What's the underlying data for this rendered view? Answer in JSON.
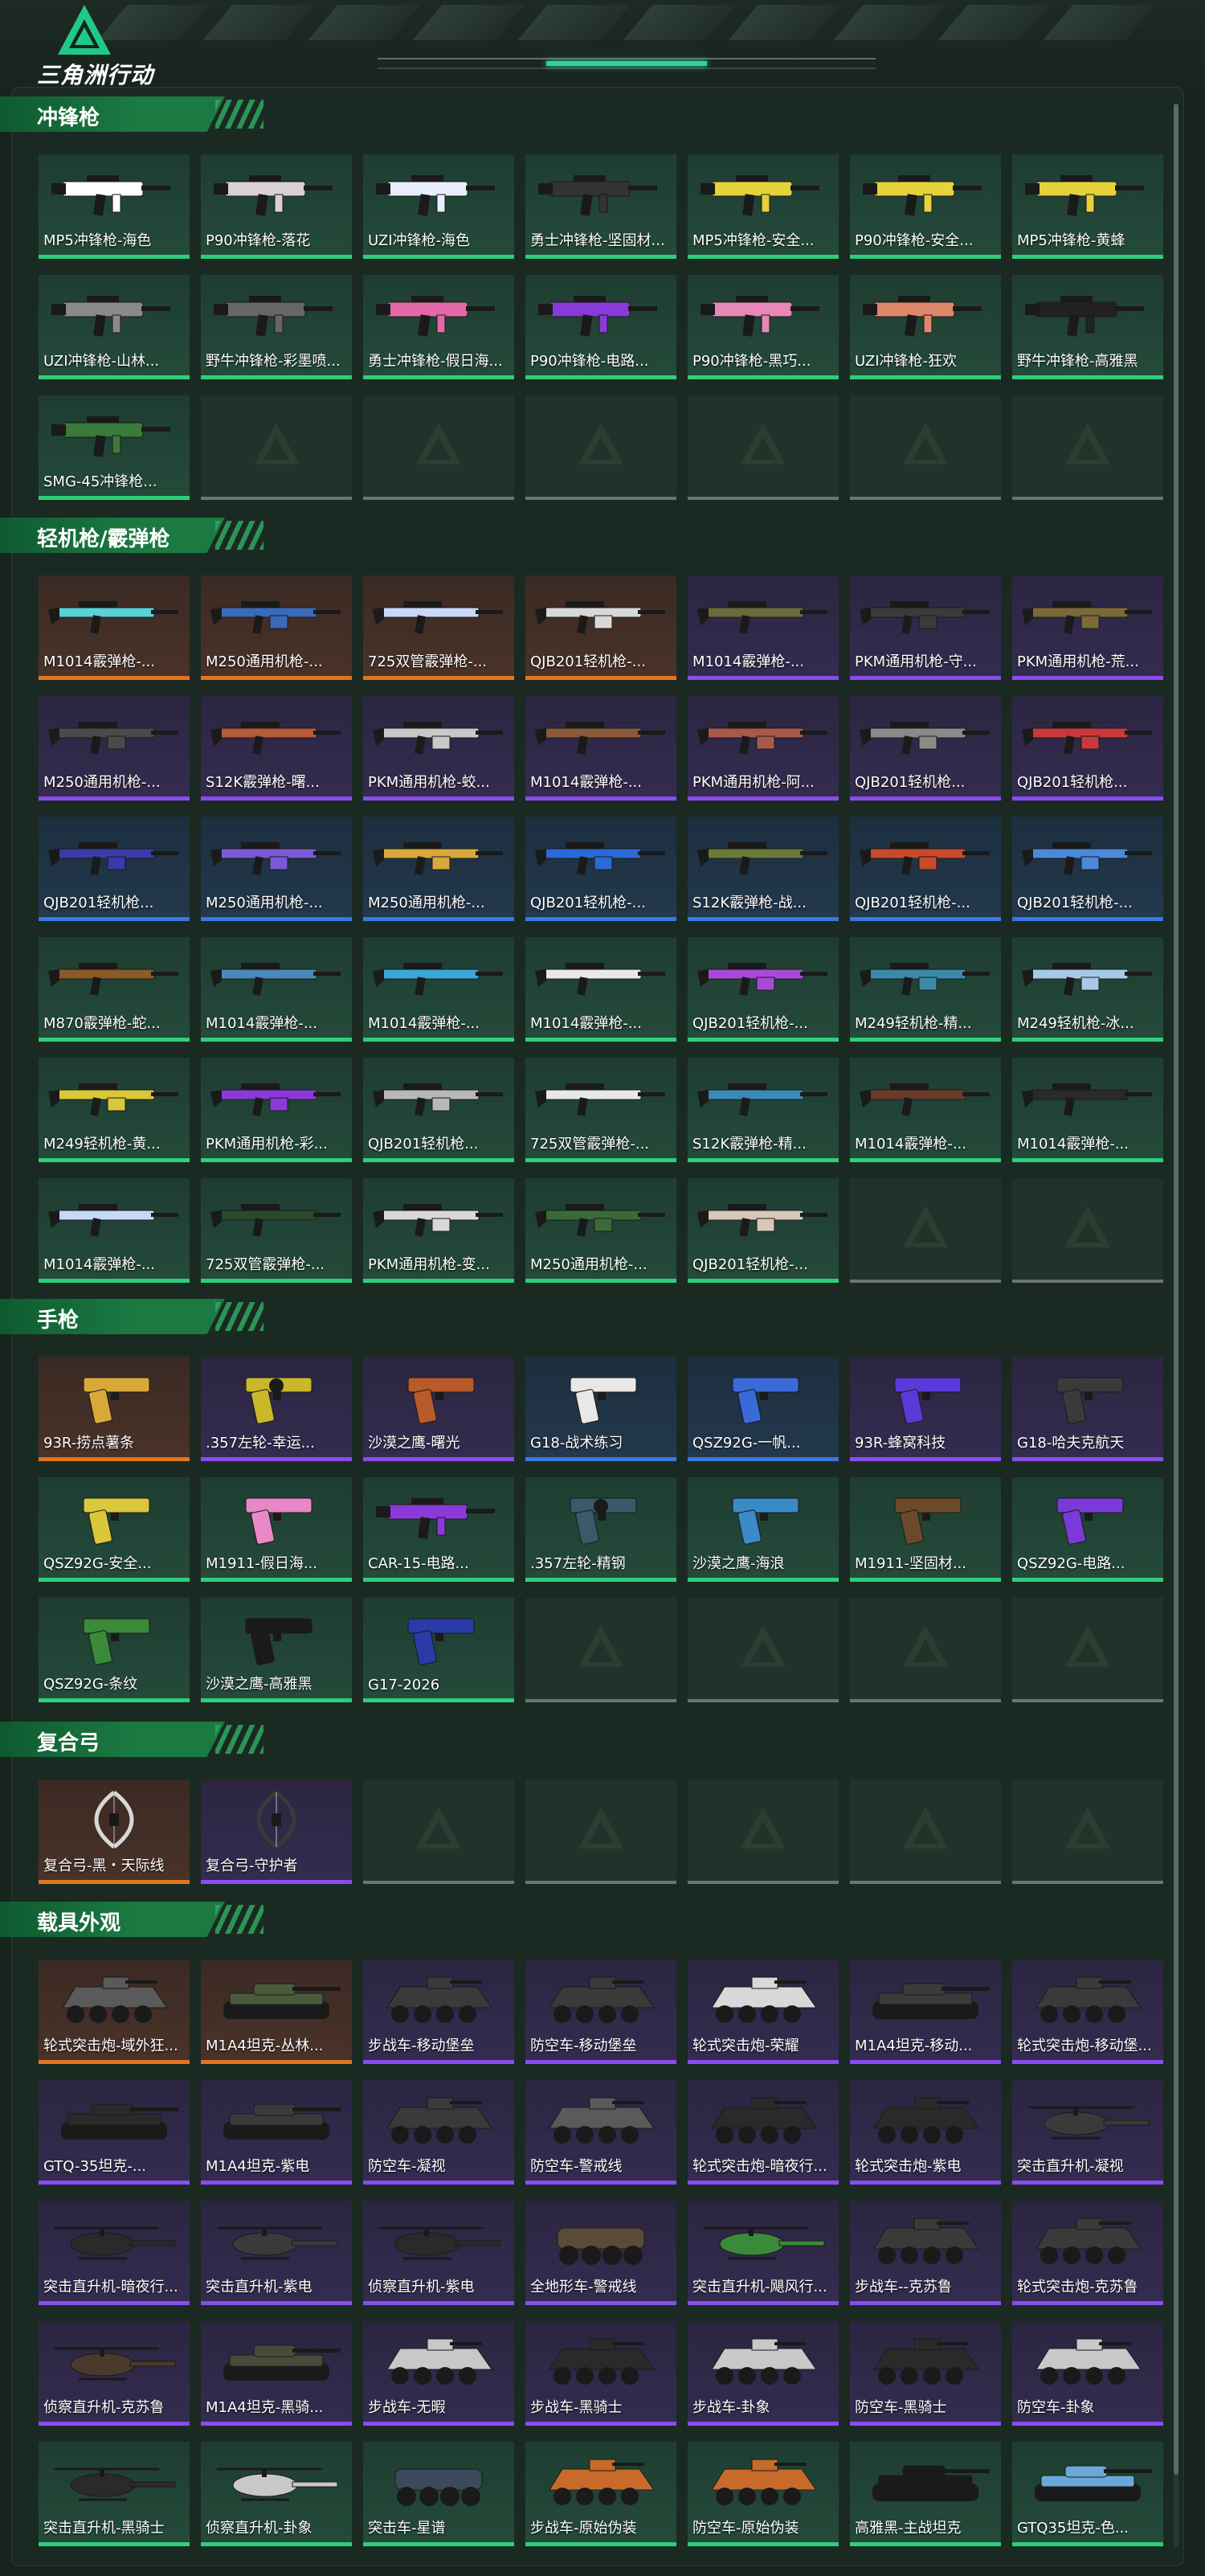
{
  "header": {
    "brand": "三角洲行动",
    "logo_icon": "delta-triangle-logo-icon"
  },
  "rarity_colors": {
    "green": "#2ecf7a",
    "blue": "#3a78e0",
    "purple": "#8a4cf0",
    "orange": "#e0761e",
    "empty": "#6b756f"
  },
  "sections": [
    {
      "title": "冲锋枪",
      "items": [
        {
          "label": "MP5冲锋枪-海色",
          "rarity": "green",
          "icon": "smg-icon",
          "color": "#ffffff"
        },
        {
          "label": "P90冲锋枪-落花",
          "rarity": "green",
          "icon": "smg-p90-icon",
          "color": "#d9d0d8"
        },
        {
          "label": "UZI冲锋枪-海色",
          "rarity": "green",
          "icon": "smg-icon",
          "color": "#e8eefc"
        },
        {
          "label": "勇士冲锋枪-坚固材...",
          "rarity": "green",
          "icon": "smg-icon",
          "color": "#333333"
        },
        {
          "label": "MP5冲锋枪-安全...",
          "rarity": "green",
          "icon": "smg-icon",
          "color": "#e6d23a"
        },
        {
          "label": "P90冲锋枪-安全...",
          "rarity": "green",
          "icon": "smg-p90-icon",
          "color": "#e6d23a"
        },
        {
          "label": "MP5冲锋枪-黄蜂",
          "rarity": "green",
          "icon": "smg-icon",
          "color": "#e6d23a"
        },
        {
          "label": "UZI冲锋枪-山林...",
          "rarity": "green",
          "icon": "smg-icon",
          "color": "#8a8a8a"
        },
        {
          "label": "野牛冲锋枪-彩墨喷...",
          "rarity": "green",
          "icon": "smg-icon",
          "color": "#666666"
        },
        {
          "label": "勇士冲锋枪-假日海...",
          "rarity": "green",
          "icon": "smg-icon",
          "color": "#e36aa8"
        },
        {
          "label": "P90冲锋枪-电路...",
          "rarity": "green",
          "icon": "smg-p90-icon",
          "color": "#8a3ad8"
        },
        {
          "label": "P90冲锋枪-黑巧...",
          "rarity": "green",
          "icon": "smg-p90-icon",
          "color": "#e888b8"
        },
        {
          "label": "UZI冲锋枪-狂欢",
          "rarity": "green",
          "icon": "smg-icon",
          "color": "#e0866a"
        },
        {
          "label": "野牛冲锋枪-高雅黑",
          "rarity": "green",
          "icon": "smg-icon",
          "color": "#222222"
        },
        {
          "label": "SMG-45冲锋枪...",
          "rarity": "green",
          "icon": "smg-icon",
          "color": "#3a7a3a"
        },
        {
          "empty": true
        },
        {
          "empty": true
        },
        {
          "empty": true
        },
        {
          "empty": true
        },
        {
          "empty": true
        },
        {
          "empty": true
        }
      ]
    },
    {
      "title": "轻机枪/霰弹枪",
      "items": [
        {
          "label": "M1014霰弹枪-...",
          "rarity": "orange",
          "icon": "shotgun-icon",
          "color": "#5ad0d8"
        },
        {
          "label": "M250通用机枪-...",
          "rarity": "orange",
          "icon": "lmg-icon",
          "color": "#3a6ab8"
        },
        {
          "label": "725双管霰弹枪-...",
          "rarity": "orange",
          "icon": "shotgun-icon",
          "color": "#c8d8f8"
        },
        {
          "label": "QJB201轻机枪-...",
          "rarity": "orange",
          "icon": "lmg-icon",
          "color": "#d8d8d8"
        },
        {
          "label": "M1014霰弹枪-...",
          "rarity": "purple",
          "icon": "shotgun-icon",
          "color": "#6a6a3a"
        },
        {
          "label": "PKM通用机枪-守...",
          "rarity": "purple",
          "icon": "lmg-icon",
          "color": "#3a3a3a"
        },
        {
          "label": "PKM通用机枪-荒...",
          "rarity": "purple",
          "icon": "lmg-icon",
          "color": "#7a6a3a"
        },
        {
          "label": "M250通用机枪-...",
          "rarity": "purple",
          "icon": "lmg-icon",
          "color": "#4a4a4a"
        },
        {
          "label": "S12K霰弹枪-曙...",
          "rarity": "purple",
          "icon": "shotgun-icon",
          "color": "#b85a3a"
        },
        {
          "label": "PKM通用机枪-蛟...",
          "rarity": "purple",
          "icon": "lmg-icon",
          "color": "#c8c8c8"
        },
        {
          "label": "M1014霰弹枪-...",
          "rarity": "purple",
          "icon": "shotgun-icon",
          "color": "#8a5a3a"
        },
        {
          "label": "PKM通用机枪-阿...",
          "rarity": "purple",
          "icon": "lmg-icon",
          "color": "#a85a4a"
        },
        {
          "label": "QJB201轻机枪...",
          "rarity": "purple",
          "icon": "lmg-icon",
          "color": "#8a8a8a"
        },
        {
          "label": "QJB201轻机枪...",
          "rarity": "purple",
          "icon": "lmg-icon",
          "color": "#c83a3a"
        },
        {
          "label": "QJB201轻机枪...",
          "rarity": "blue",
          "icon": "lmg-icon",
          "color": "#3a3aa8"
        },
        {
          "label": "M250通用机枪-...",
          "rarity": "blue",
          "icon": "lmg-icon",
          "color": "#7a5ad8"
        },
        {
          "label": "M250通用机枪-...",
          "rarity": "blue",
          "icon": "lmg-icon",
          "color": "#d8a83a"
        },
        {
          "label": "QJB201轻机枪-...",
          "rarity": "blue",
          "icon": "lmg-icon",
          "color": "#2a6ad8"
        },
        {
          "label": "S12K霰弹枪-战...",
          "rarity": "blue",
          "icon": "shotgun-icon",
          "color": "#6a7a3a"
        },
        {
          "label": "QJB201轻机枪-...",
          "rarity": "blue",
          "icon": "lmg-icon",
          "color": "#c84a2a"
        },
        {
          "label": "QJB201轻机枪-...",
          "rarity": "blue",
          "icon": "lmg-icon",
          "color": "#4a8ad8"
        },
        {
          "label": "M870霰弹枪-蛇...",
          "rarity": "green",
          "icon": "shotgun-icon",
          "color": "#8a5a2a"
        },
        {
          "label": "M1014霰弹枪-...",
          "rarity": "green",
          "icon": "shotgun-icon",
          "color": "#4a8ab8"
        },
        {
          "label": "M1014霰弹枪-...",
          "rarity": "green",
          "icon": "shotgun-icon",
          "color": "#3aa8d8"
        },
        {
          "label": "M1014霰弹枪-...",
          "rarity": "green",
          "icon": "shotgun-icon",
          "color": "#e8e8e8"
        },
        {
          "label": "QJB201轻机枪-...",
          "rarity": "green",
          "icon": "lmg-icon",
          "color": "#a84ad8"
        },
        {
          "label": "M249轻机枪-精...",
          "rarity": "green",
          "icon": "lmg-icon",
          "color": "#3a8aa8"
        },
        {
          "label": "M249轻机枪-冰...",
          "rarity": "green",
          "icon": "lmg-icon",
          "color": "#a8c8e8"
        },
        {
          "label": "M249轻机枪-黄...",
          "rarity": "green",
          "icon": "lmg-icon",
          "color": "#d8c83a"
        },
        {
          "label": "PKM通用机枪-彩...",
          "rarity": "green",
          "icon": "lmg-icon",
          "color": "#8a3ad8"
        },
        {
          "label": "QJB201轻机枪...",
          "rarity": "green",
          "icon": "lmg-icon",
          "color": "#b8b8b8"
        },
        {
          "label": "725双管霰弹枪-...",
          "rarity": "green",
          "icon": "shotgun-icon",
          "color": "#e8e8e8"
        },
        {
          "label": "S12K霰弹枪-精...",
          "rarity": "green",
          "icon": "shotgun-icon",
          "color": "#3a8ab8"
        },
        {
          "label": "M1014霰弹枪-...",
          "rarity": "green",
          "icon": "shotgun-icon",
          "color": "#6a3a2a"
        },
        {
          "label": "M1014霰弹枪-...",
          "rarity": "green",
          "icon": "shotgun-icon",
          "color": "#2a2a2a"
        },
        {
          "label": "M1014霰弹枪-...",
          "rarity": "green",
          "icon": "shotgun-icon",
          "color": "#c8d8f8"
        },
        {
          "label": "725双管霰弹枪-...",
          "rarity": "green",
          "icon": "shotgun-icon",
          "color": "#2a4a2a"
        },
        {
          "label": "PKM通用机枪-变...",
          "rarity": "green",
          "icon": "lmg-icon",
          "color": "#d8d8d8"
        },
        {
          "label": "M250通用机枪-...",
          "rarity": "green",
          "icon": "lmg-icon",
          "color": "#3a6a3a"
        },
        {
          "label": "QJB201轻机枪-...",
          "rarity": "green",
          "icon": "lmg-icon",
          "color": "#d8c8b8"
        },
        {
          "empty": true
        },
        {
          "empty": true
        }
      ]
    },
    {
      "title": "手枪",
      "items": [
        {
          "label": "93R-捞点薯条",
          "rarity": "orange",
          "icon": "pistol-icon",
          "color": "#d8a83a"
        },
        {
          "label": ".357左轮-幸运...",
          "rarity": "purple",
          "icon": "revolver-icon",
          "color": "#c8b82a"
        },
        {
          "label": "沙漠之鹰-曙光",
          "rarity": "purple",
          "icon": "pistol-icon",
          "color": "#b85a2a"
        },
        {
          "label": "G18-战术练习",
          "rarity": "blue",
          "icon": "pistol-icon",
          "color": "#e8e8e8"
        },
        {
          "label": "QSZ92G-一帆...",
          "rarity": "blue",
          "icon": "pistol-icon",
          "color": "#3a6ad8"
        },
        {
          "label": "93R-蜂窝科技",
          "rarity": "purple",
          "icon": "pistol-icon",
          "color": "#5a3ad8"
        },
        {
          "label": "G18-哈夫克航天",
          "rarity": "purple",
          "icon": "pistol-icon",
          "color": "#3a3a3a"
        },
        {
          "label": "QSZ92G-安全...",
          "rarity": "green",
          "icon": "pistol-icon",
          "color": "#d8c83a"
        },
        {
          "label": "M1911-假日海...",
          "rarity": "green",
          "icon": "pistol-icon",
          "color": "#e888c8"
        },
        {
          "label": "CAR-15-电路...",
          "rarity": "green",
          "icon": "smg-icon",
          "color": "#8a3ad8"
        },
        {
          "label": ".357左轮-精钢",
          "rarity": "green",
          "icon": "revolver-icon",
          "color": "#3a5a6a"
        },
        {
          "label": "沙漠之鹰-海浪",
          "rarity": "green",
          "icon": "pistol-icon",
          "color": "#3a8ac8"
        },
        {
          "label": "M1911-坚固材...",
          "rarity": "green",
          "icon": "pistol-icon",
          "color": "#6a4a2a"
        },
        {
          "label": "QSZ92G-电路...",
          "rarity": "green",
          "icon": "pistol-icon",
          "color": "#7a3ad8"
        },
        {
          "label": "QSZ92G-条纹",
          "rarity": "green",
          "icon": "pistol-icon",
          "color": "#3a8a3a"
        },
        {
          "label": "沙漠之鹰-高雅黑",
          "rarity": "green",
          "icon": "pistol-icon",
          "color": "#1a1a1a"
        },
        {
          "label": "G17-2026",
          "rarity": "green",
          "icon": "pistol-icon",
          "color": "#2a3aa8"
        },
        {
          "empty": true
        },
        {
          "empty": true
        },
        {
          "empty": true
        },
        {
          "empty": true
        }
      ]
    },
    {
      "title": "复合弓",
      "items": [
        {
          "label": "复合弓-黑・天际线",
          "rarity": "orange",
          "icon": "bow-icon",
          "color": "#d8d8d8"
        },
        {
          "label": "复合弓-守护者",
          "rarity": "purple",
          "icon": "bow-icon",
          "color": "#3a3a3a"
        },
        {
          "empty": true
        },
        {
          "empty": true
        },
        {
          "empty": true
        },
        {
          "empty": true
        },
        {
          "empty": true
        }
      ]
    },
    {
      "title": "载具外观",
      "items": [
        {
          "label": "轮式突击炮-域外狂...",
          "rarity": "orange",
          "icon": "apc-vehicle-icon",
          "color": "#5a5a5a"
        },
        {
          "label": "M1A4坦克-丛林...",
          "rarity": "orange",
          "icon": "tank-icon",
          "color": "#4a5a3a"
        },
        {
          "label": "步战车-移动堡垒",
          "rarity": "purple",
          "icon": "apc-vehicle-icon",
          "color": "#3a3a3a"
        },
        {
          "label": "防空车-移动堡垒",
          "rarity": "purple",
          "icon": "apc-vehicle-icon",
          "color": "#3a3a3a"
        },
        {
          "label": "轮式突击炮-荣耀",
          "rarity": "purple",
          "icon": "apc-vehicle-icon",
          "color": "#d8d8d8"
        },
        {
          "label": "M1A4坦克-移动...",
          "rarity": "purple",
          "icon": "tank-icon",
          "color": "#3a3a3a"
        },
        {
          "label": "轮式突击炮-移动堡...",
          "rarity": "purple",
          "icon": "apc-vehicle-icon",
          "color": "#3a3a3a"
        },
        {
          "label": "GTQ-35坦克-...",
          "rarity": "purple",
          "icon": "tank-icon",
          "color": "#2a2a2a"
        },
        {
          "label": "M1A4坦克-紫电",
          "rarity": "purple",
          "icon": "tank-icon",
          "color": "#3a3a3a"
        },
        {
          "label": "防空车-凝视",
          "rarity": "purple",
          "icon": "apc-vehicle-icon",
          "color": "#3a3a3a"
        },
        {
          "label": "防空车-警戒线",
          "rarity": "purple",
          "icon": "apc-vehicle-icon",
          "color": "#5a5a5a"
        },
        {
          "label": "轮式突击炮-暗夜行...",
          "rarity": "purple",
          "icon": "apc-vehicle-icon",
          "color": "#2a2a2a"
        },
        {
          "label": "轮式突击炮-紫电",
          "rarity": "purple",
          "icon": "apc-vehicle-icon",
          "color": "#2a2a2a"
        },
        {
          "label": "突击直升机-凝视",
          "rarity": "purple",
          "icon": "helicopter-icon",
          "color": "#3a3a3a"
        },
        {
          "label": "突击直升机-暗夜行...",
          "rarity": "purple",
          "icon": "helicopter-icon",
          "color": "#2a2a2a"
        },
        {
          "label": "突击直升机-紫电",
          "rarity": "purple",
          "icon": "helicopter-icon",
          "color": "#3a3a3a"
        },
        {
          "label": "侦察直升机-紫电",
          "rarity": "purple",
          "icon": "helicopter-icon",
          "color": "#2a2a2a"
        },
        {
          "label": "全地形车-警戒线",
          "rarity": "purple",
          "icon": "atv-icon",
          "color": "#5a4a3a"
        },
        {
          "label": "突击直升机-飓风行...",
          "rarity": "purple",
          "icon": "helicopter-icon",
          "color": "#3a8a3a"
        },
        {
          "label": "步战车--克苏鲁",
          "rarity": "purple",
          "icon": "apc-vehicle-icon",
          "color": "#3a3a3a"
        },
        {
          "label": "轮式突击炮-克苏鲁",
          "rarity": "purple",
          "icon": "apc-vehicle-icon",
          "color": "#3a3a3a"
        },
        {
          "label": "侦察直升机-克苏鲁",
          "rarity": "purple",
          "icon": "helicopter-icon",
          "color": "#4a3a2a"
        },
        {
          "label": "M1A4坦克-黑骑...",
          "rarity": "purple",
          "icon": "tank-icon",
          "color": "#4a4a3a"
        },
        {
          "label": "步战车-无暇",
          "rarity": "purple",
          "icon": "apc-vehicle-icon",
          "color": "#c8c8c8"
        },
        {
          "label": "步战车-黑骑士",
          "rarity": "purple",
          "icon": "apc-vehicle-icon",
          "color": "#2a2a2a"
        },
        {
          "label": "步战车-卦象",
          "rarity": "purple",
          "icon": "apc-vehicle-icon",
          "color": "#c8c8c8"
        },
        {
          "label": "防空车-黑骑士",
          "rarity": "purple",
          "icon": "apc-vehicle-icon",
          "color": "#2a2a2a"
        },
        {
          "label": "防空车-卦象",
          "rarity": "purple",
          "icon": "apc-vehicle-icon",
          "color": "#c8c8c8"
        },
        {
          "label": "突击直升机-黑骑士",
          "rarity": "green",
          "icon": "helicopter-icon",
          "color": "#2a2a2a"
        },
        {
          "label": "侦察直升机-卦象",
          "rarity": "green",
          "icon": "helicopter-icon",
          "color": "#c8c8c8"
        },
        {
          "label": "突击车-星谱",
          "rarity": "green",
          "icon": "atv-icon",
          "color": "#3a4a5a"
        },
        {
          "label": "步战车-原始伪装",
          "rarity": "green",
          "icon": "apc-vehicle-icon",
          "color": "#c86a2a"
        },
        {
          "label": "防空车-原始伪装",
          "rarity": "green",
          "icon": "apc-vehicle-icon",
          "color": "#c86a2a"
        },
        {
          "label": "高雅黑-主战坦克",
          "rarity": "green",
          "icon": "tank-icon",
          "color": "#1a1a1a"
        },
        {
          "label": "GTQ35坦克-色...",
          "rarity": "green",
          "icon": "tank-icon",
          "color": "#6aa8d8"
        }
      ]
    }
  ]
}
